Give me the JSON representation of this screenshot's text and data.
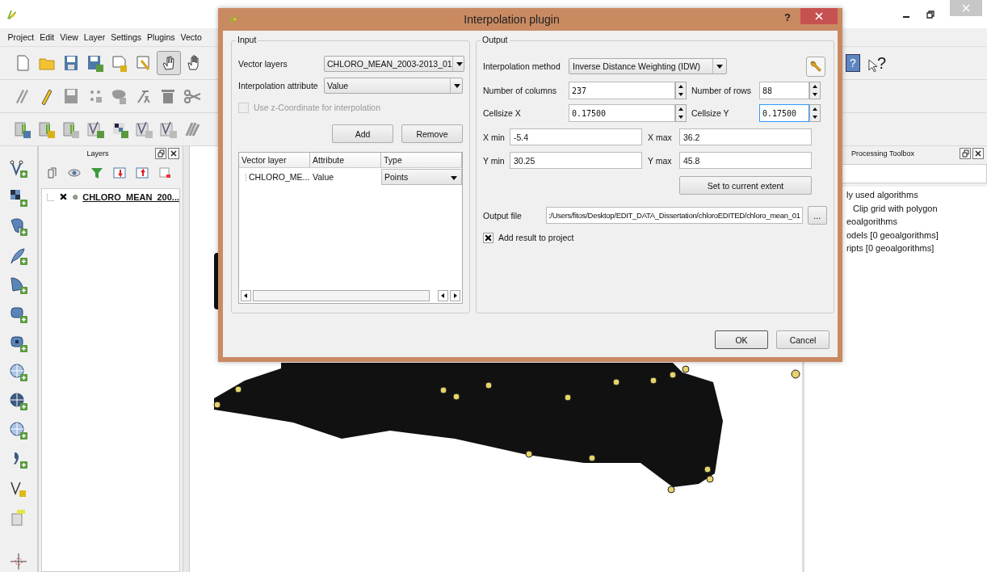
{
  "main_window": {
    "menu": [
      "Project",
      "Edit",
      "View",
      "Layer",
      "Settings",
      "Plugins",
      "Vecto"
    ],
    "pan_tool": {
      "selected": true
    },
    "help_mark": "?",
    "whats_this_mark": "?"
  },
  "layers_panel": {
    "title": "Layers",
    "layers": [
      {
        "name": "CHLORO_MEAN_200...",
        "visible": true
      }
    ]
  },
  "processing_toolbox": {
    "title": "Processing Toolbox",
    "items": [
      {
        "label": "ly used algorithms",
        "children": [
          {
            "label": "Clip grid with polygon"
          }
        ]
      },
      {
        "label": "eoalgorithms"
      },
      {
        "label": "odels [0 geoalgorithms]"
      },
      {
        "label": "ripts [0 geoalgorithms]"
      }
    ]
  },
  "dialog": {
    "title": "Interpolation plugin",
    "help": "?",
    "input": {
      "title": "Input",
      "vector_layers": {
        "label": "Vector layers",
        "value": "CHLORO_MEAN_2003-2013_01"
      },
      "attribute": {
        "label": "Interpolation attribute",
        "value": "Value"
      },
      "z_coordinate": {
        "label": "Use z-Coordinate for interpolation",
        "checked": false,
        "disabled": true
      },
      "buttons": [
        "Add",
        "Remove"
      ],
      "table": {
        "columns": [
          "Vector layer",
          "Attribute",
          "Type"
        ],
        "rows": [
          {
            "layer": "CHLORO_ME...",
            "attribute": "Value",
            "type": "Points"
          }
        ]
      }
    },
    "output": {
      "title": "Output",
      "method": {
        "label": "Interpolation method",
        "value": "Inverse Distance Weighting (IDW)"
      },
      "columns": {
        "label": "Number of columns",
        "value": "237",
        "focused": false
      },
      "rows": {
        "label": "Number of rows",
        "value": "88",
        "focused": false
      },
      "cellsize_x": {
        "label": "Cellsize X",
        "value": "0.17500",
        "focused": false
      },
      "cellsize_y": {
        "label": "Cellsize Y",
        "value": "0.17500",
        "focused": true
      },
      "x_min": {
        "label": "X min",
        "value": "-5.4"
      },
      "x_max": {
        "label": "X max",
        "value": "36.2"
      },
      "y_min": {
        "label": "Y min",
        "value": "30.25"
      },
      "y_max": {
        "label": "Y max",
        "value": "45.8"
      },
      "extent_button": "Set to current extent",
      "output_file": {
        "label": "Output file",
        "value": ":/Users/fitos/Desktop/EDIT_DATA_Dissertation/chloroEDITED/chloro_mean_01"
      },
      "browse": "...",
      "add_result": {
        "label": "Add result to project",
        "checked": true
      }
    },
    "buttons": [
      "OK",
      "Cancel"
    ]
  }
}
